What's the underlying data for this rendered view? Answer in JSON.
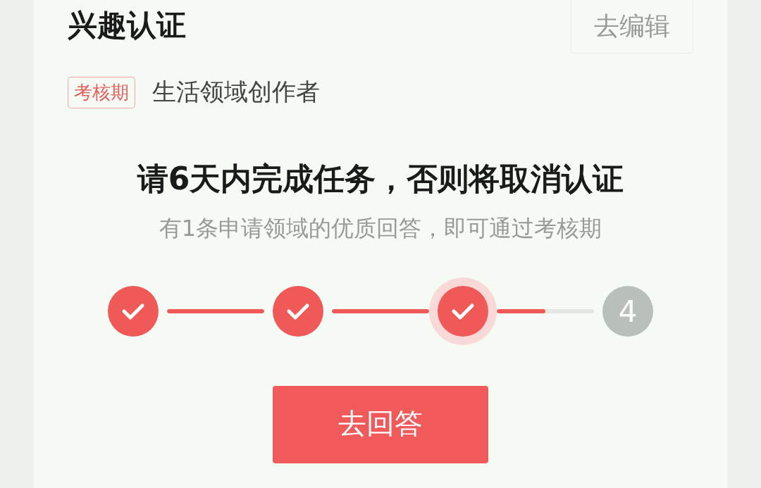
{
  "header": {
    "title": "兴趣认证",
    "edit_button": "去编辑"
  },
  "field": {
    "tag": "考核期",
    "name": "生活领域创作者"
  },
  "notice": {
    "heading": "请6天内完成任务，否则将取消认证",
    "subtitle": "有1条申请领域的优质回答，即可通过考核期"
  },
  "steps": [
    {
      "kind": "done",
      "current": false
    },
    {
      "kind": "done",
      "current": false
    },
    {
      "kind": "done",
      "current": true
    },
    {
      "kind": "number",
      "current": false,
      "label": "4"
    }
  ],
  "connectors": [
    {
      "level": 1
    },
    {
      "level": 1
    },
    {
      "level": 0.5
    }
  ],
  "action_button": "去回答"
}
